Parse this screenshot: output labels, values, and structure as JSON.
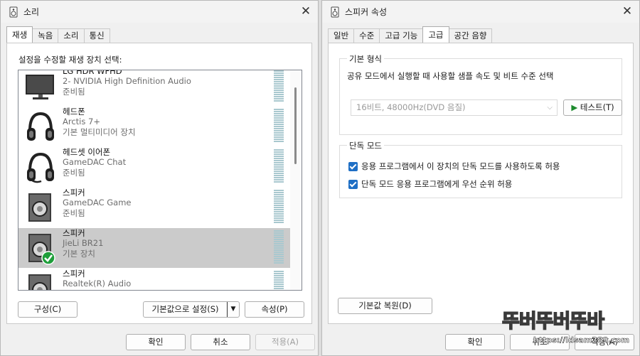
{
  "left_window": {
    "title": "소리",
    "close": "✕",
    "tabs": [
      "재생",
      "녹음",
      "소리",
      "통신"
    ],
    "instruction": "설정을 수정할 재생 장치 선택:",
    "devices": [
      {
        "name": "LG HDR WFHD",
        "line2": "2- NVIDIA High Definition Audio",
        "line3": "준비됨",
        "icon": "monitor-icon"
      },
      {
        "name": "헤드폰",
        "line2": "Arctis 7+",
        "line3": "기본 멀티미디어 장치",
        "icon": "headphones-icon"
      },
      {
        "name": "헤드셋 이어폰",
        "line2": "GameDAC Chat",
        "line3": "준비됨",
        "icon": "headset-icon"
      },
      {
        "name": "스피커",
        "line2": "GameDAC Game",
        "line3": "준비됨",
        "icon": "speaker-icon"
      },
      {
        "name": "스피커",
        "line2": "JieLi BR21",
        "line3": "기본 장치",
        "icon": "speaker-default-icon"
      },
      {
        "name": "스피커",
        "line2": "Realtek(R) Audio",
        "line3": "",
        "icon": "speaker-icon"
      }
    ],
    "buttons": {
      "configure": "구성(C)",
      "set_default": "기본값으로 설정(S)",
      "properties": "속성(P)",
      "ok": "확인",
      "cancel": "취소",
      "apply": "적용(A)"
    }
  },
  "right_window": {
    "title": "스피커 속성",
    "close": "✕",
    "tabs": [
      "일반",
      "수준",
      "고급 기능",
      "고급",
      "공간 음향"
    ],
    "default_format": {
      "label": "기본 형식",
      "description": "공유 모드에서 실행할 때 사용할 샘플 속도 및 비트 수준 선택",
      "selected": "16비트, 48000Hz(DVD 음질)",
      "test_button": "테스트(T)"
    },
    "exclusive_mode": {
      "label": "단독 모드",
      "option1": "응용 프로그램에서 이 장치의 단독 모드를 사용하도록 허용",
      "option2": "단독 모드 응용 프로그램에게 우선 순위 허용"
    },
    "restore_button": "기본값 복원(D)",
    "buttons": {
      "ok": "확인",
      "cancel": "취소",
      "apply": "적용(A)"
    }
  },
  "watermark": {
    "line1": "뚜버뚜버뚜바",
    "line2": "https://ldsam289.com"
  },
  "colors": {
    "selected_row": "#cbcbcb",
    "checkbox": "#1f6fc5",
    "default_check": "#1e9e3a",
    "test_arrow": "#1c8a2c"
  }
}
